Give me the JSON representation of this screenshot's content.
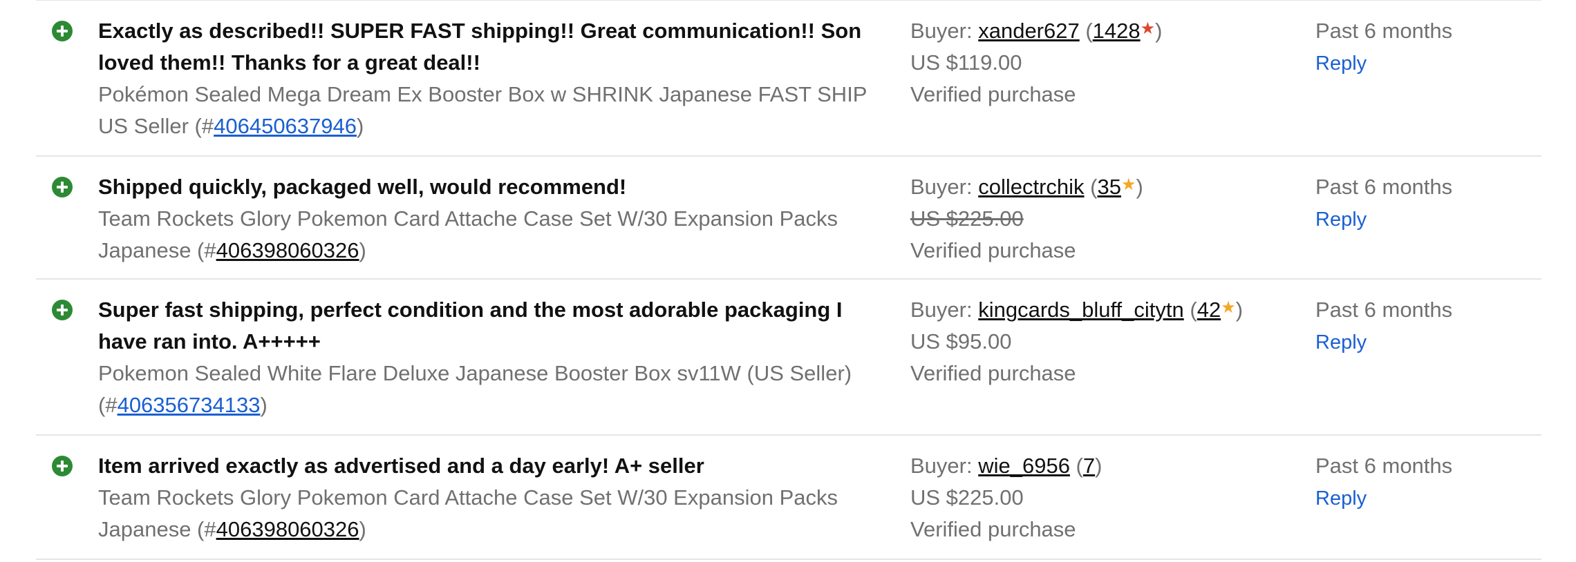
{
  "colors": {
    "positive_icon": "#2d8a34",
    "link_blue": "#1a5fd1",
    "muted_text": "#707070",
    "divider": "#e5e5e5",
    "star_red": "#d9492f",
    "star_orange": "#f5a623"
  },
  "feedback": [
    {
      "rating_icon": "plus-circle-icon",
      "comment_line1": "Exactly as described!! SUPER FAST shipping!! Great communication!! Son",
      "comment_line2": "loved them!! Thanks for a great deal!!",
      "item_line1": "Pokémon Sealed Mega Dream Ex Booster Box w SHRINK Japanese FAST SHIP",
      "item_line2_prefix": "US Seller (#",
      "item_number": "406450637946",
      "item_suffix": ")",
      "buyer_label": "Buyer: ",
      "buyer_name": "xander627",
      "score_open": " (",
      "score": "1428",
      "star": "★",
      "star_color": "#d9492f",
      "score_close": ")",
      "price": "US $119.00",
      "price_struck": false,
      "verified": "Verified purchase",
      "when": "Past 6 months",
      "reply": "Reply"
    },
    {
      "rating_icon": "plus-circle-icon",
      "comment_line1": "Shipped quickly, packaged well, would recommend!",
      "item_line1": "Team Rockets Glory Pokemon Card Attache Case Set W/30 Expansion Packs",
      "item_line2_prefix": "Japanese (#",
      "item_number": "406398060326",
      "item_suffix": ")",
      "buyer_label": "Buyer: ",
      "buyer_name": "collectrchik",
      "score_open": " (",
      "score": "35",
      "star": "★",
      "star_color": "#f5a623",
      "score_close": ")",
      "price": "US $225.00",
      "price_struck": true,
      "verified": "Verified purchase",
      "when": "Past 6 months",
      "reply": "Reply"
    },
    {
      "rating_icon": "plus-circle-icon",
      "comment_line1": "Super fast shipping, perfect condition and the most adorable packaging I",
      "comment_line2": "have ran into. A+++++",
      "item_line1": "Pokemon Sealed White Flare Deluxe Japanese Booster Box sv11W (US Seller)",
      "item_line2_prefix": "(#",
      "item_number": "406356734133",
      "item_suffix": ")",
      "buyer_label": "Buyer: ",
      "buyer_name": "kingcards_bluff_citytn",
      "score_open": " (",
      "score": "42",
      "star": "★",
      "star_color": "#f5a623",
      "score_close": ")",
      "price": "US $95.00",
      "price_struck": false,
      "verified": "Verified purchase",
      "when": "Past 6 months",
      "reply": "Reply"
    },
    {
      "rating_icon": "plus-circle-icon",
      "comment_line1": "Item arrived exactly as advertised and a day early! A+ seller",
      "item_line1": "Team Rockets Glory Pokemon Card Attache Case Set W/30 Expansion Packs",
      "item_line2_prefix": "Japanese (#",
      "item_number": "406398060326",
      "item_suffix": ")",
      "buyer_label": "Buyer: ",
      "buyer_name": "wie_6956",
      "score_open": " (",
      "score": "7",
      "score_close": ")",
      "price": "US $225.00",
      "price_struck": false,
      "verified": "Verified purchase",
      "when": "Past 6 months",
      "reply": "Reply"
    }
  ]
}
